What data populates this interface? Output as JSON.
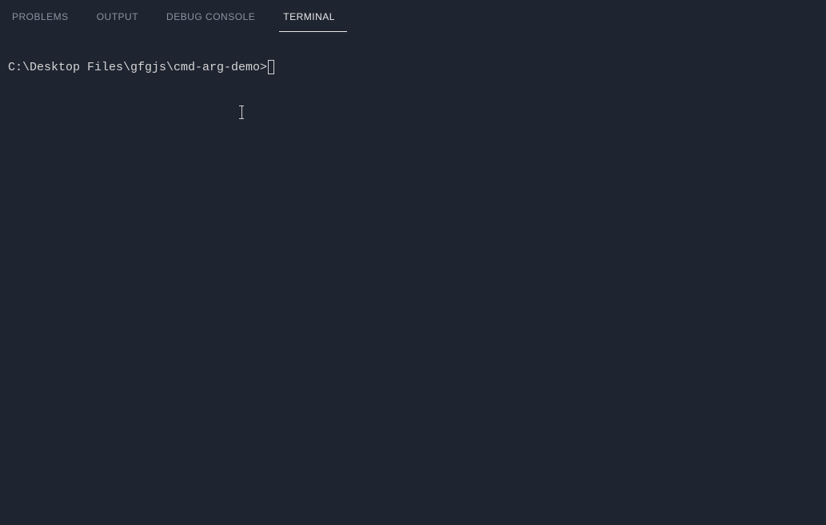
{
  "tabs": {
    "problems": "PROBLEMS",
    "output": "OUTPUT",
    "debug_console": "DEBUG CONSOLE",
    "terminal": "TERMINAL"
  },
  "terminal": {
    "prompt": "C:\\Desktop Files\\gfgjs\\cmd-arg-demo>"
  }
}
